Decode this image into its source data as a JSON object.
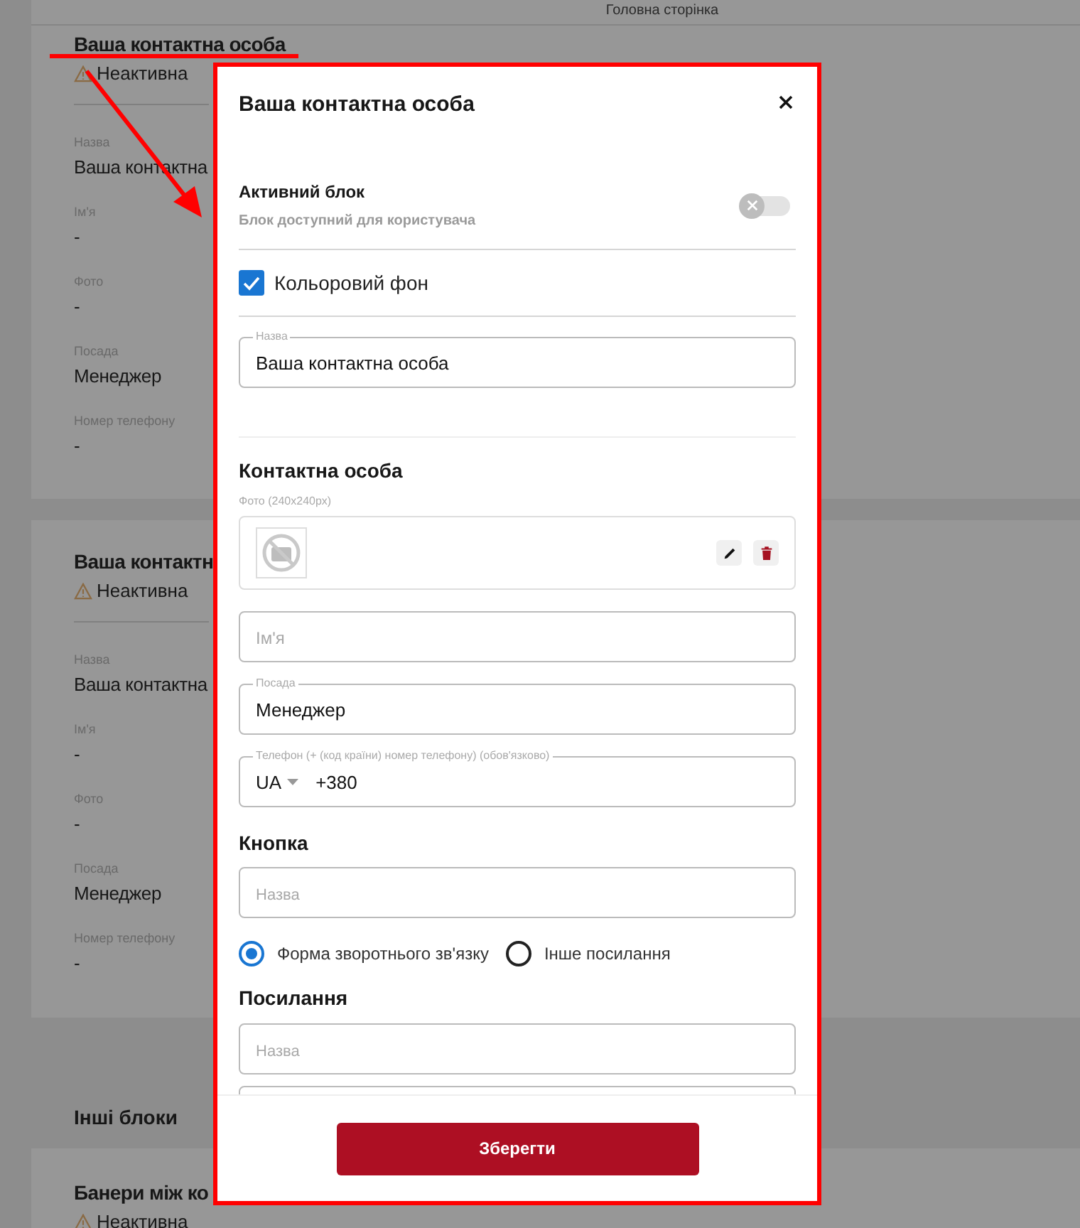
{
  "header": {
    "title": "Головна сторінка"
  },
  "blocks": [
    {
      "title": "Ваша контактна особа",
      "status": "Неактивна",
      "fields": [
        {
          "label": "Назва",
          "value": "Ваша контактна"
        },
        {
          "label": "Ім'я",
          "value": "-"
        },
        {
          "label": "Фото",
          "value": "-"
        },
        {
          "label": "Посада",
          "value": "Менеджер"
        },
        {
          "label": "Номер телефону",
          "value": "-"
        }
      ]
    },
    {
      "title": "Ваша контактн",
      "status": "Неактивна",
      "fields": [
        {
          "label": "Назва",
          "value": "Ваша контактна"
        },
        {
          "label": "Ім'я",
          "value": "-"
        },
        {
          "label": "Фото",
          "value": "-"
        },
        {
          "label": "Посада",
          "value": "Менеджер"
        },
        {
          "label": "Номер телефону",
          "value": "-"
        }
      ]
    }
  ],
  "other_section": {
    "title": "Інші блоки"
  },
  "other_blocks": [
    {
      "title": "Банери між ко",
      "status": "Неактивна"
    }
  ],
  "modal": {
    "title": "Ваша контактна особа",
    "active_block": {
      "title": "Активний блок",
      "subtitle": "Блок доступний для користувача",
      "on": false
    },
    "colored_background": {
      "label": "Кольоровий фон",
      "checked": true
    },
    "name_field": {
      "label": "Назва",
      "value": "Ваша контактна особа"
    },
    "contact_section": {
      "title": "Контактна особа",
      "photo_label": "Фото (240x240px)"
    },
    "first_name_field": {
      "placeholder": "Ім'я"
    },
    "position_field": {
      "label": "Посада",
      "value": "Менеджер"
    },
    "phone_field": {
      "label": "Телефон (+ (код країни) номер телефону) (обов'язково)",
      "country": "UA",
      "value": "+380"
    },
    "button_section": {
      "title": "Кнопка",
      "placeholder": "Назва"
    },
    "link_options": [
      {
        "label": "Форма зворотнього зв'язку",
        "selected": true
      },
      {
        "label": "Інше посилання",
        "selected": false
      }
    ],
    "link_section": {
      "title": "Посилання",
      "placeholder": "Назва"
    },
    "save_button": "Зберегти"
  }
}
